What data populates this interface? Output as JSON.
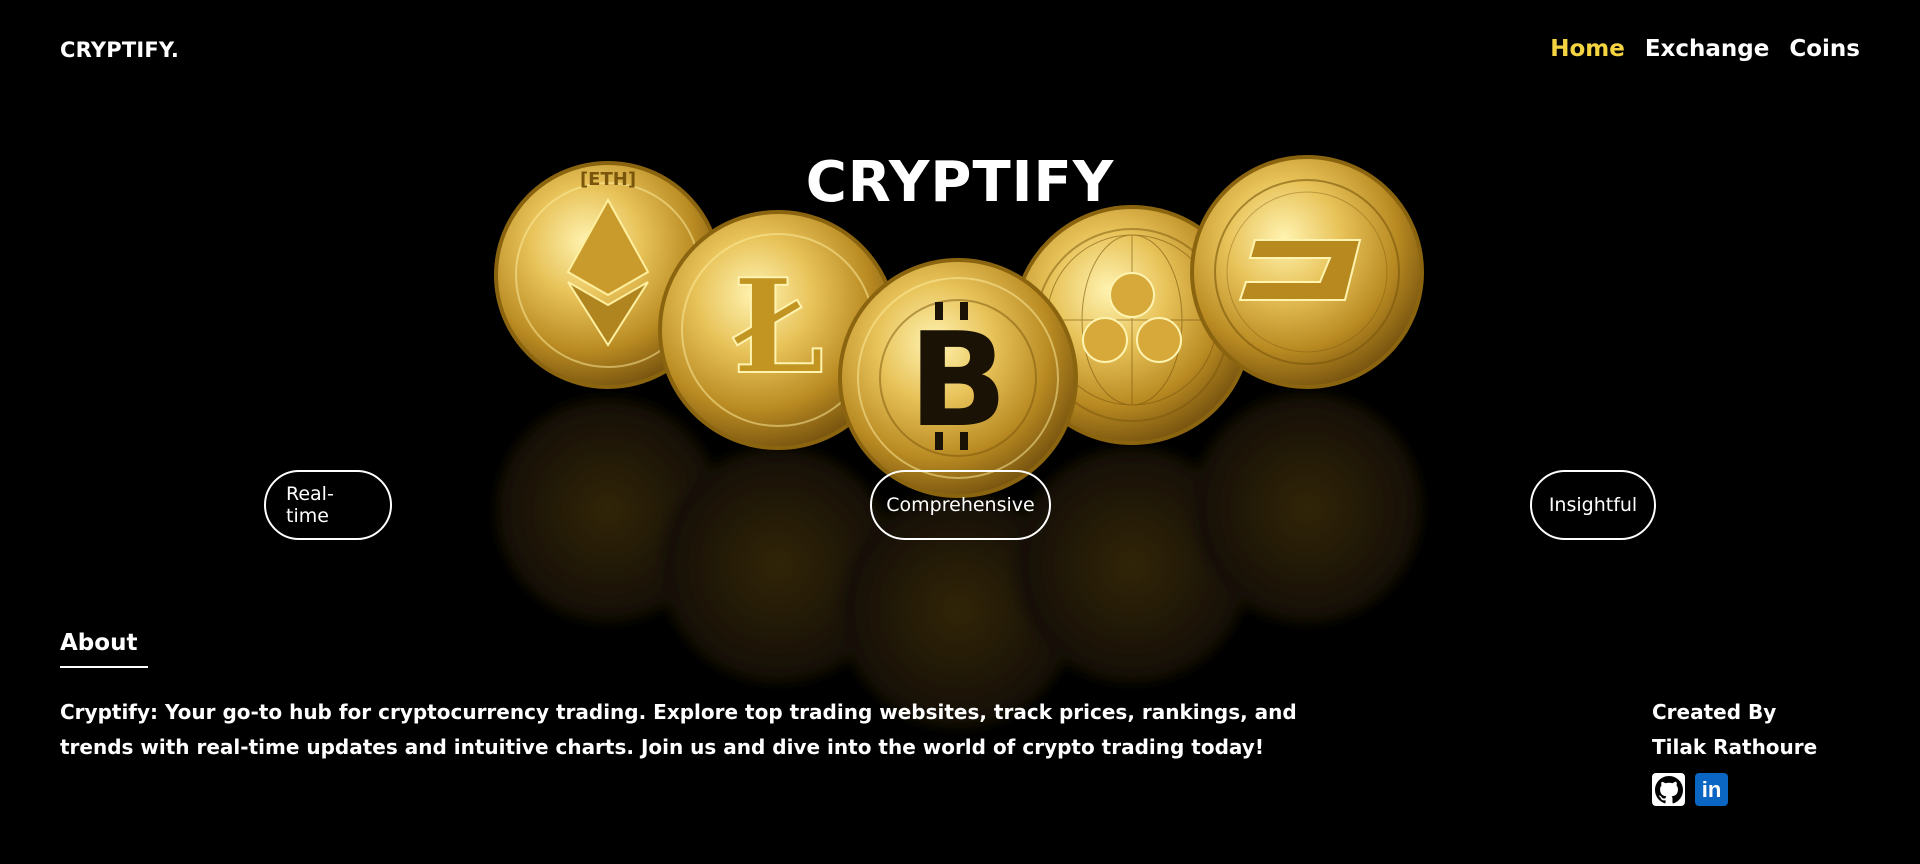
{
  "header": {
    "brand": "CRYPTIFY.",
    "nav": [
      {
        "label": "Home",
        "active": true
      },
      {
        "label": "Exchange",
        "active": false
      },
      {
        "label": "Coins",
        "active": false
      }
    ]
  },
  "hero": {
    "title": "CRYPTIFY",
    "coins": [
      "ETH",
      "Litecoin",
      "Bitcoin",
      "Ripple",
      "Dash"
    ],
    "pills": [
      "Real-time",
      "Comprehensive",
      "Insightful"
    ]
  },
  "about": {
    "title": "About",
    "text": "Cryptify: Your go-to hub for cryptocurrency trading. Explore top trading websites, track prices, rankings, and trends with real-time updates and intuitive charts. Join us and dive into the world of crypto trading today!"
  },
  "credit": {
    "label": "Created By",
    "name": "Tilak Rathoure",
    "socials": [
      "github-icon",
      "linkedin-icon"
    ]
  },
  "colors": {
    "background": "#000000",
    "accent": "#f5d442",
    "gold": "#d4a838",
    "linkedin": "#0a66c2"
  }
}
